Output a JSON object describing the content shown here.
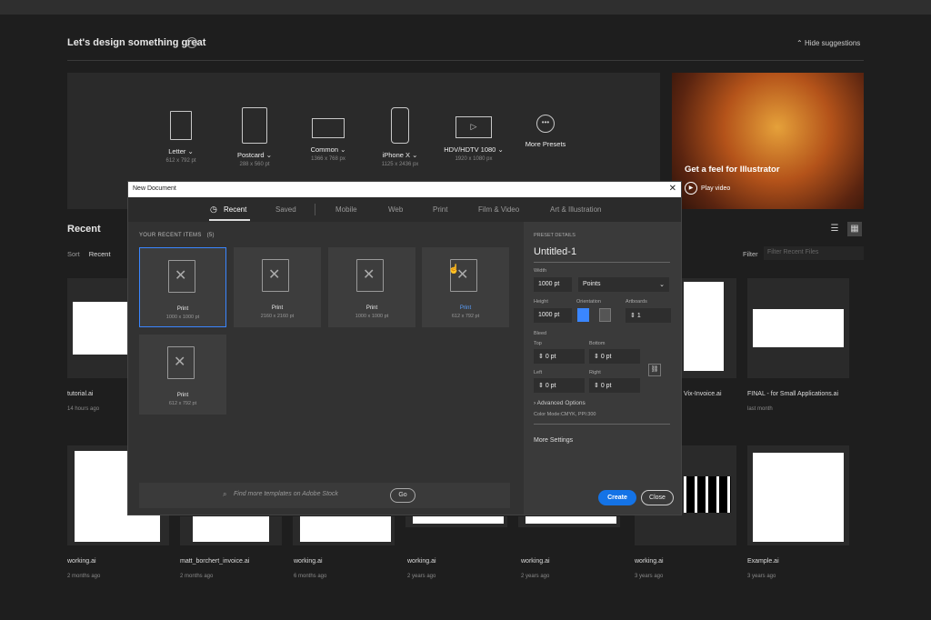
{
  "header": {
    "title": "Let's design something great",
    "hide_label": "Hide suggestions"
  },
  "presets": [
    {
      "name": "Letter",
      "size": "612 x 792 pt",
      "icon": "letter-icon"
    },
    {
      "name": "Postcard",
      "size": "288 x 560 pt",
      "icon": "postcard-icon"
    },
    {
      "name": "Common",
      "size": "1366 x 768 px",
      "icon": "common-icon"
    },
    {
      "name": "iPhone X",
      "size": "1125 x 2436 px",
      "icon": "iphone-icon"
    },
    {
      "name": "HDV/HDTV 1080",
      "size": "1920 x 1080 px",
      "icon": "video-icon"
    },
    {
      "name": "More Presets",
      "size": "",
      "icon": "more-icon"
    }
  ],
  "video": {
    "title": "Get a feel for Illustrator",
    "play": "Play video"
  },
  "recent": {
    "title": "Recent",
    "sort_label": "Sort",
    "sort_value": "Recent",
    "filter_label": "Filter",
    "filter_placeholder": "Filter Recent Files"
  },
  "files_row1": [
    {
      "name": "tutorial.ai",
      "date": "14 hours ago"
    },
    {
      "name": "Vix-Invoice.ai",
      "date": ""
    },
    {
      "name": "FINAL - for Small Applications.ai",
      "date": "last month"
    }
  ],
  "files_row2": [
    {
      "name": "working.ai",
      "date": "2 months ago"
    },
    {
      "name": "matt_borchert_invoice.ai",
      "date": "2 months ago"
    },
    {
      "name": "working.ai",
      "date": "6 months ago"
    },
    {
      "name": "working.ai",
      "date": "2 years ago"
    },
    {
      "name": "working.ai",
      "date": "2 years ago"
    },
    {
      "name": "working.ai",
      "date": "3 years ago"
    },
    {
      "name": "Example.ai",
      "date": "3 years ago"
    }
  ],
  "dialog": {
    "title": "New Document",
    "tabs": [
      "Recent",
      "Saved",
      "Mobile",
      "Web",
      "Print",
      "Film & Video",
      "Art & Illustration"
    ],
    "recent_header": "YOUR RECENT ITEMS",
    "recent_count": "(5)",
    "items": [
      {
        "name": "Print",
        "size": "1000 x 1000 pt"
      },
      {
        "name": "Print",
        "size": "2160 x 2160 pt"
      },
      {
        "name": "Print",
        "size": "1000 x 1000 pt"
      },
      {
        "name": "Print",
        "size": "612 x 792 pt"
      },
      {
        "name": "Print",
        "size": "612 x 792 pt"
      }
    ],
    "template_search": "Find more templates on Adobe Stock",
    "go_label": "Go",
    "details": {
      "header": "PRESET DETAILS",
      "name": "Untitled-1",
      "width_label": "Width",
      "width": "1000 pt",
      "units": "Points",
      "height_label": "Height",
      "height": "1000 pt",
      "orientation_label": "Orientation",
      "artboards_label": "Artboards",
      "artboards": "1",
      "bleed_label": "Bleed",
      "top_label": "Top",
      "top": "0 pt",
      "bottom_label": "Bottom",
      "bottom": "0 pt",
      "left_label": "Left",
      "left": "0 pt",
      "right_label": "Right",
      "right": "0 pt",
      "advanced": "Advanced Options",
      "color_mode": "Color Mode:CMYK, PPI:300",
      "more_settings": "More Settings",
      "create": "Create",
      "close": "Close"
    }
  }
}
